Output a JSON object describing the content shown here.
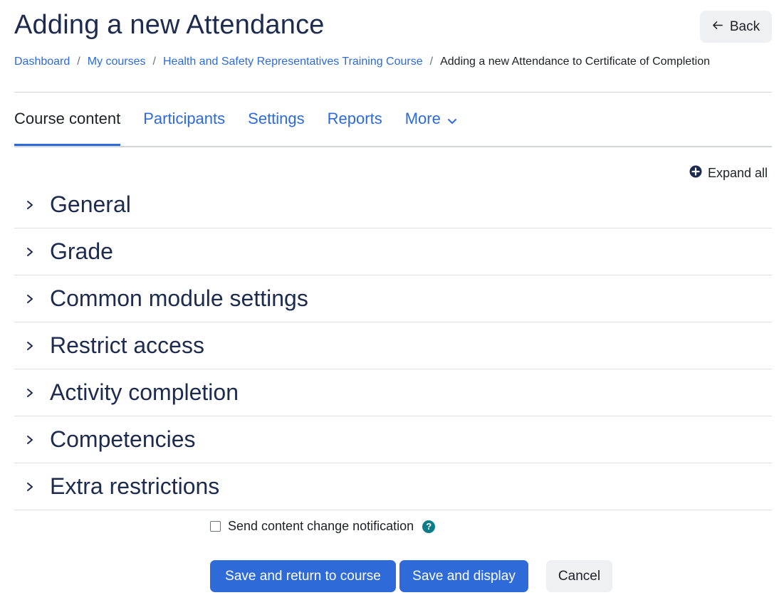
{
  "header": {
    "title": "Adding a new Attendance",
    "back_label": "Back"
  },
  "breadcrumb": {
    "items": [
      "Dashboard",
      "My courses",
      "Health and Safety Representatives Training Course"
    ],
    "current": "Adding a new Attendance to Certificate of Completion",
    "separator": "/"
  },
  "tabs": [
    {
      "label": "Course content"
    },
    {
      "label": "Participants"
    },
    {
      "label": "Settings"
    },
    {
      "label": "Reports"
    },
    {
      "label": "More"
    }
  ],
  "expand_all_label": "Expand all",
  "sections": [
    {
      "label": "General"
    },
    {
      "label": "Grade"
    },
    {
      "label": "Common module settings"
    },
    {
      "label": "Restrict access"
    },
    {
      "label": "Activity completion"
    },
    {
      "label": "Competencies"
    },
    {
      "label": "Extra restrictions"
    }
  ],
  "notification": {
    "label": "Send content change notification",
    "help_icon_text": "?"
  },
  "buttons": {
    "save_return": "Save and return to course",
    "save_display": "Save and display",
    "cancel": "Cancel"
  },
  "colors": {
    "accent": "#2e6bd8",
    "heading": "#1d2b4f",
    "help": "#0f7d89"
  },
  "icons": {
    "back": "arrow-left-icon",
    "more": "chevron-down-icon",
    "expand_all": "plus-circle-icon",
    "section": "chevron-right-icon"
  }
}
